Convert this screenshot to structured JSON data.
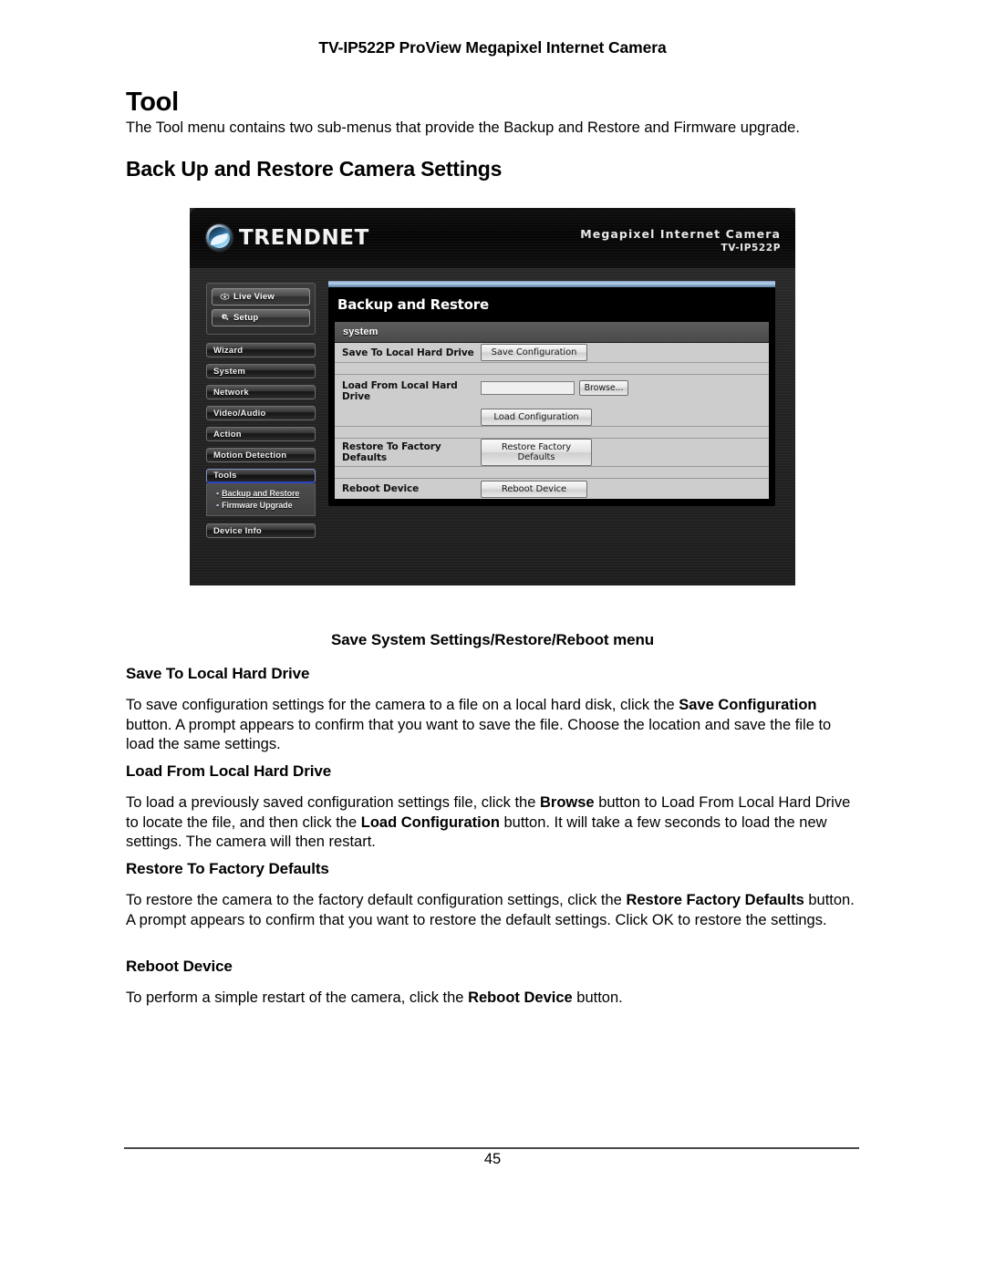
{
  "document": {
    "running_header": "TV-IP522P ProView Megapixel Internet Camera",
    "h1": "Tool",
    "intro": "The Tool menu contains two sub-menus that provide the Backup and Restore and Firmware upgrade.",
    "h2": "Back Up and Restore Camera Settings",
    "figure_caption": "Save System Settings/Restore/Reboot menu",
    "page_number": "45"
  },
  "sections": [
    {
      "heading": "Save To Local Hard Drive",
      "parts": [
        {
          "t": "To save configuration settings for the camera to a file on a local hard disk, click the ",
          "b": false
        },
        {
          "t": "Save Configuration",
          "b": true
        },
        {
          "t": " button. A prompt appears to confirm that you want to save the file. Choose the location and save the file to load the same settings.",
          "b": false
        }
      ]
    },
    {
      "heading": "Load From Local Hard Drive",
      "parts": [
        {
          "t": "To load a previously saved configuration settings file, click the ",
          "b": false
        },
        {
          "t": "Browse",
          "b": true
        },
        {
          "t": " button to Load From Local Hard Drive to locate the file, and then click the ",
          "b": false
        },
        {
          "t": "Load Configuration",
          "b": true
        },
        {
          "t": " button. It will take a few seconds to load the new settings. The camera will then restart.",
          "b": false
        }
      ]
    },
    {
      "heading": "Restore To Factory Defaults",
      "parts": [
        {
          "t": "To restore the camera to the factory default configuration settings, click the ",
          "b": false
        },
        {
          "t": "Restore Factory Defaults",
          "b": true
        },
        {
          "t": " button. A prompt appears to confirm that you want to restore the default settings. Click OK to restore the settings.",
          "b": false
        }
      ]
    },
    {
      "heading": "Reboot Device",
      "parts": [
        {
          "t": "To perform a simple restart of the camera, click the ",
          "b": false
        },
        {
          "t": "Reboot Device",
          "b": true
        },
        {
          "t": " button.",
          "b": false
        }
      ]
    }
  ],
  "screenshot": {
    "brand": {
      "logo_text_upper": "TREND",
      "logo_text_lower": "NET",
      "product_line1": "Megapixel Internet Camera",
      "product_line2": "TV-IP522P"
    },
    "sidebar": {
      "top_buttons": [
        {
          "label": "Live View",
          "icon": "eye-icon"
        },
        {
          "label": "Setup",
          "icon": "gear-icon"
        }
      ],
      "nav": [
        {
          "label": "Wizard",
          "active": false
        },
        {
          "label": "System",
          "active": false
        },
        {
          "label": "Network",
          "active": false
        },
        {
          "label": "Video/Audio",
          "active": false
        },
        {
          "label": "Action",
          "active": false
        },
        {
          "label": "Motion Detection",
          "active": false
        }
      ],
      "tools": {
        "label": "Tools",
        "active": true
      },
      "tools_submenu": [
        {
          "label": "Backup and Restore",
          "selected": true
        },
        {
          "label": "Firmware Upgrade",
          "selected": false
        }
      ],
      "nav_bottom": [
        {
          "label": "Device Info",
          "active": false
        }
      ]
    },
    "panel": {
      "title": "Backup and Restore",
      "table_header": "system",
      "rows": [
        {
          "label": "Save To Local Hard Drive",
          "button": "Save Configuration"
        },
        {
          "label": "Load From Local Hard Drive",
          "file_value": "",
          "browse_button": "Browse...",
          "button": "Load Configuration"
        },
        {
          "label": "Restore To Factory Defaults",
          "button": "Restore Factory Defaults"
        },
        {
          "label": "Reboot Device",
          "button": "Reboot Device"
        }
      ]
    },
    "colors": {
      "accent_blue": "#2b44c8",
      "panel_bar": "#b9d4ef",
      "chrome_dark": "#1e1e1e",
      "row_grey": "#cdcdcd"
    }
  }
}
